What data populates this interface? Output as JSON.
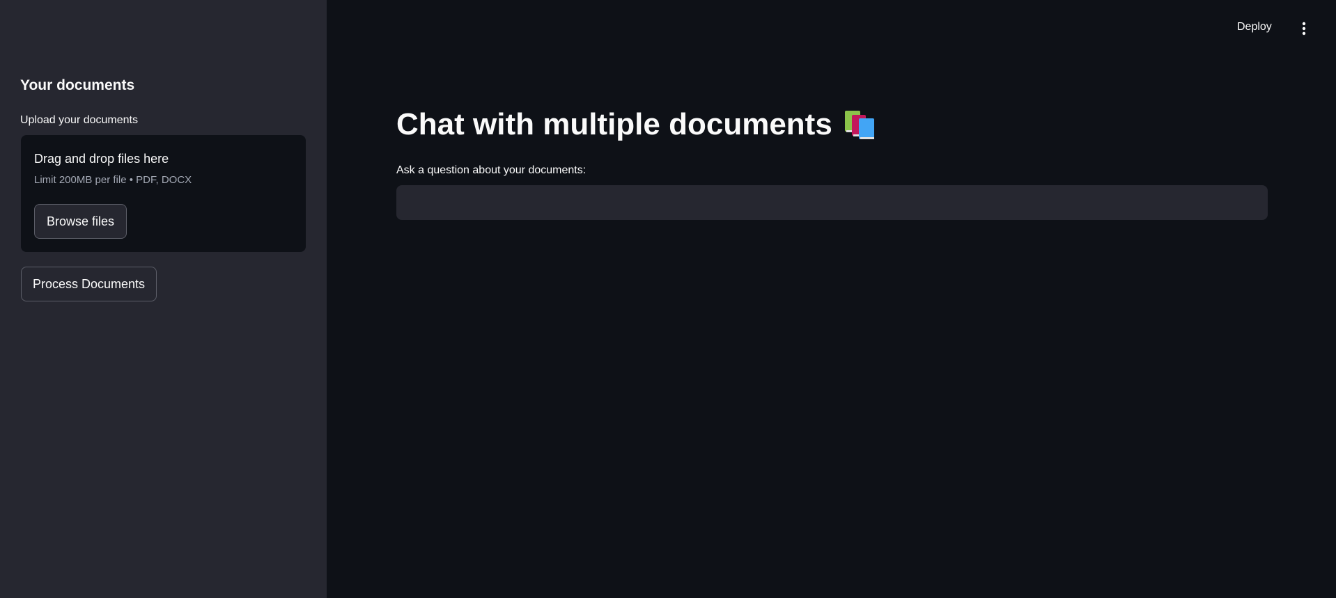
{
  "header": {
    "deploy_label": "Deploy",
    "menu_icon": "vertical-ellipsis-icon"
  },
  "sidebar": {
    "heading": "Your documents",
    "uploader": {
      "label": "Upload your documents",
      "drop_title": "Drag and drop files here",
      "limit_text": "Limit 200MB per file • PDF, DOCX",
      "browse_label": "Browse files"
    },
    "process_label": "Process Documents"
  },
  "main": {
    "title": "Chat with multiple documents",
    "title_icon": "books-icon",
    "question_label": "Ask a question about your documents:",
    "question_value": "",
    "question_placeholder": ""
  },
  "colors": {
    "background": "#0e1117",
    "sidebar": "#262730",
    "text": "#fafafa",
    "muted_text": "#a3a8b4",
    "input_bg": "#262730"
  }
}
